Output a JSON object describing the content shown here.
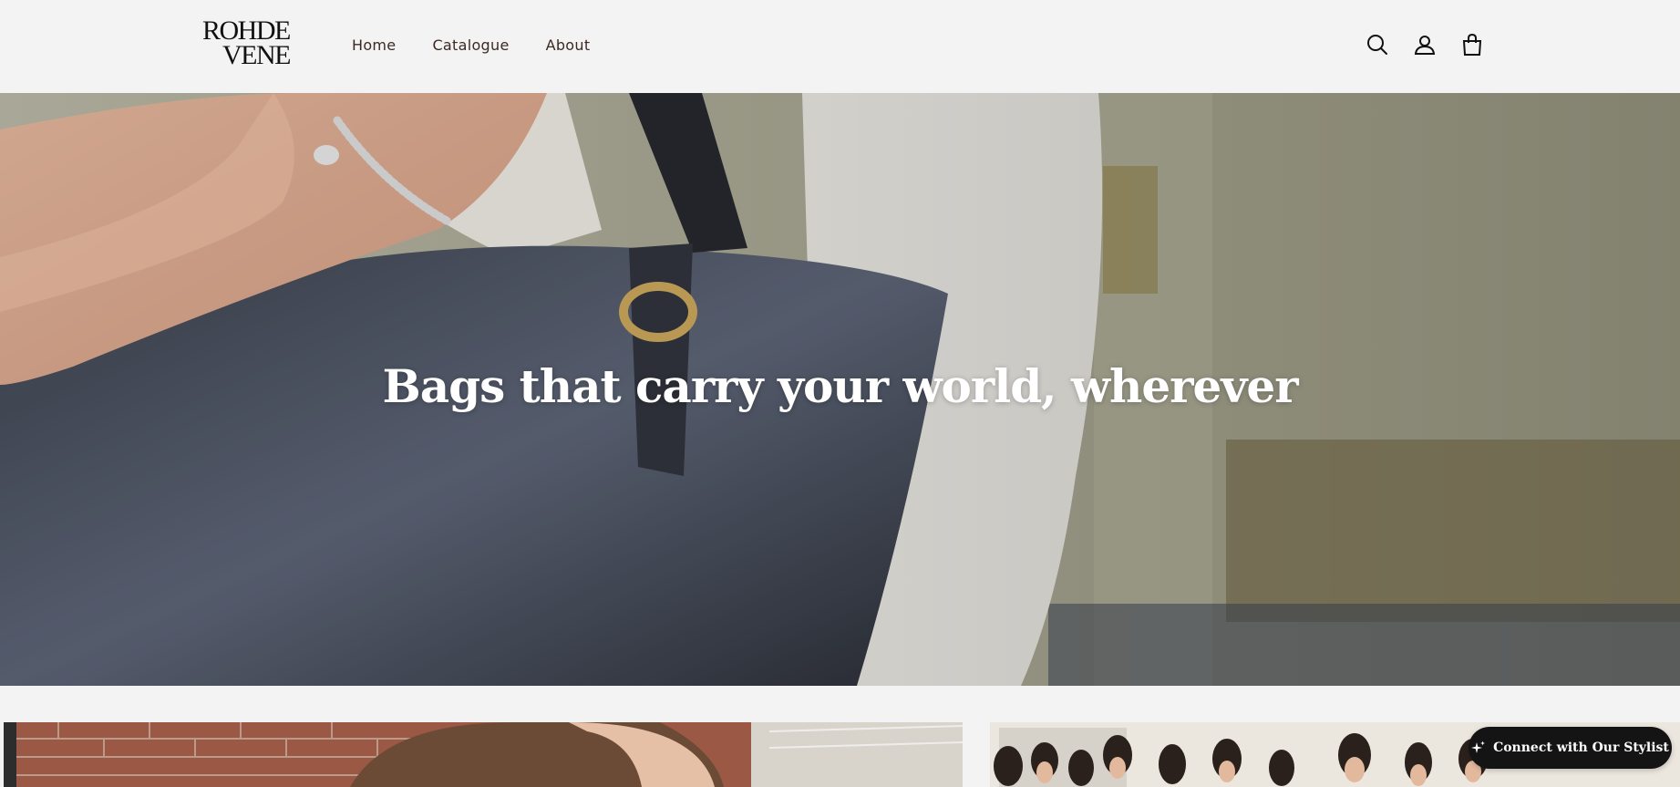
{
  "brand": {
    "logo_line1": "ROHDE",
    "logo_line2": "VENE"
  },
  "nav": {
    "items": [
      {
        "label": "Home"
      },
      {
        "label": "Catalogue"
      },
      {
        "label": "About"
      }
    ]
  },
  "header_icons": [
    "search-icon",
    "account-icon",
    "cart-icon"
  ],
  "hero": {
    "title": "Bags that carry your world, wherever"
  },
  "floating": {
    "stylist_label": "Connect with Our Stylist",
    "icon": "sparkle-icon"
  },
  "colors": {
    "background": "#f3f3f3",
    "button_bg": "#141414",
    "nav_text": "#3c2a22"
  }
}
